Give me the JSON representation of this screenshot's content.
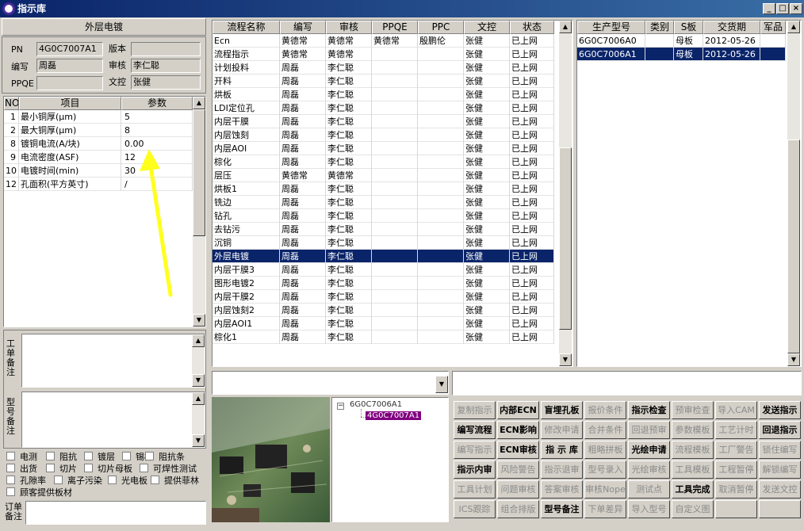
{
  "window": {
    "title": "指示库",
    "min": "_",
    "max": "□",
    "close": "×"
  },
  "left": {
    "section_title": "外层电镀",
    "pn_label": "PN",
    "pn_value": "4G0C7007A1",
    "version_label": "版本",
    "version_value": "",
    "writer_label": "编写",
    "writer_value": "周磊",
    "reviewer_label": "审核",
    "reviewer_value": "李仁聪",
    "ppqe_label": "PPQE",
    "ppqe_value": "",
    "doc_label": "文控",
    "doc_value": "张健",
    "param_headers": [
      "NO",
      "项目",
      "参数"
    ],
    "params": [
      {
        "no": "1",
        "item": "最小铜厚(μm)",
        "value": "5"
      },
      {
        "no": "2",
        "item": "最大铜厚(μm)",
        "value": "8"
      },
      {
        "no": "8",
        "item": "镀铜电流(A/块)",
        "value": "0.00"
      },
      {
        "no": "9",
        "item": "电流密度(ASF)",
        "value": "12"
      },
      {
        "no": "10",
        "item": "电镀时间(min)",
        "value": "30"
      },
      {
        "no": "12",
        "item": "孔面积(平方英寸)",
        "value": "/"
      }
    ],
    "note1_label": "工单备注",
    "note2_label": "型号备注",
    "checkboxes": [
      "电测",
      "阻抗",
      "镀层",
      "锡样",
      "阻抗条",
      "出货",
      "切片",
      "切片母板",
      "可焊性测试",
      "孔隙率",
      "离子污染",
      "光电板",
      "提供菲林",
      "顾客提供板材"
    ],
    "order_note_label": "订单备注"
  },
  "process_table": {
    "headers": [
      "流程名称",
      "编写",
      "审核",
      "PPQE",
      "PPC",
      "文控",
      "状态"
    ],
    "selected_index": 17,
    "rows": [
      [
        "Ecn",
        "黄德常",
        "黄德常",
        "黄德常",
        "殷鹏伦",
        "张健",
        "已上网"
      ],
      [
        "流程指示",
        "黄德常",
        "黄德常",
        "",
        "",
        "张健",
        "已上网"
      ],
      [
        "计划投料",
        "周磊",
        "李仁聪",
        "",
        "",
        "张健",
        "已上网"
      ],
      [
        "开料",
        "周磊",
        "李仁聪",
        "",
        "",
        "张健",
        "已上网"
      ],
      [
        "烘板",
        "周磊",
        "李仁聪",
        "",
        "",
        "张健",
        "已上网"
      ],
      [
        "LDI定位孔",
        "周磊",
        "李仁聪",
        "",
        "",
        "张健",
        "已上网"
      ],
      [
        "内层干膜",
        "周磊",
        "李仁聪",
        "",
        "",
        "张健",
        "已上网"
      ],
      [
        "内层蚀刻",
        "周磊",
        "李仁聪",
        "",
        "",
        "张健",
        "已上网"
      ],
      [
        "内层AOI",
        "周磊",
        "李仁聪",
        "",
        "",
        "张健",
        "已上网"
      ],
      [
        "棕化",
        "周磊",
        "李仁聪",
        "",
        "",
        "张健",
        "已上网"
      ],
      [
        "层压",
        "黄德常",
        "黄德常",
        "",
        "",
        "张健",
        "已上网"
      ],
      [
        "烘板1",
        "周磊",
        "李仁聪",
        "",
        "",
        "张健",
        "已上网"
      ],
      [
        "铣边",
        "周磊",
        "李仁聪",
        "",
        "",
        "张健",
        "已上网"
      ],
      [
        "钻孔",
        "周磊",
        "李仁聪",
        "",
        "",
        "张健",
        "已上网"
      ],
      [
        "去钻污",
        "周磊",
        "李仁聪",
        "",
        "",
        "张健",
        "已上网"
      ],
      [
        "沉铜",
        "周磊",
        "李仁聪",
        "",
        "",
        "张健",
        "已上网"
      ],
      [
        "外层电镀",
        "周磊",
        "李仁聪",
        "",
        "",
        "张健",
        "已上网"
      ],
      [
        "内层干膜3",
        "周磊",
        "李仁聪",
        "",
        "",
        "张健",
        "已上网"
      ],
      [
        "图形电镀2",
        "周磊",
        "李仁聪",
        "",
        "",
        "张健",
        "已上网"
      ],
      [
        "内层干膜2",
        "周磊",
        "李仁聪",
        "",
        "",
        "张健",
        "已上网"
      ],
      [
        "内层蚀刻2",
        "周磊",
        "李仁聪",
        "",
        "",
        "张健",
        "已上网"
      ],
      [
        "内层AOI1",
        "周磊",
        "李仁聪",
        "",
        "",
        "张健",
        "已上网"
      ],
      [
        "棕化1",
        "周磊",
        "李仁聪",
        "",
        "",
        "张健",
        "已上网"
      ]
    ]
  },
  "product_table": {
    "headers": [
      "生产型号",
      "类别",
      "S板",
      "交货期",
      "军品"
    ],
    "rows": [
      [
        "6G0C7006A0",
        "",
        "母板",
        "2012-05-26",
        ""
      ],
      [
        "6G0C7006A1",
        "",
        "母板",
        "2012-05-26",
        ""
      ]
    ]
  },
  "tree": {
    "root": "6G0C7006A1",
    "child": "4G0C7007A1"
  },
  "buttons": [
    [
      {
        "t": "复制指示",
        "s": "dis"
      },
      {
        "t": "内部ECN",
        "s": "en"
      },
      {
        "t": "盲埋孔板",
        "s": "en"
      },
      {
        "t": "报价条件",
        "s": "dis"
      },
      {
        "t": "指示检查",
        "s": "en"
      },
      {
        "t": "预审检查",
        "s": "dis"
      },
      {
        "t": "导入CAM",
        "s": "dis"
      },
      {
        "t": "发送指示",
        "s": "en"
      }
    ],
    [
      {
        "t": "编写流程",
        "s": "en"
      },
      {
        "t": "ECN影响",
        "s": "en"
      },
      {
        "t": "修改申请",
        "s": "dis"
      },
      {
        "t": "合并条件",
        "s": "dis"
      },
      {
        "t": "回退预审",
        "s": "dis"
      },
      {
        "t": "参数模板",
        "s": "dis"
      },
      {
        "t": "工艺计时",
        "s": "dis"
      },
      {
        "t": "回退指示",
        "s": "en"
      }
    ],
    [
      {
        "t": "编写指示",
        "s": "dis"
      },
      {
        "t": "ECN审核",
        "s": "en"
      },
      {
        "t": "指 示 库",
        "s": "en"
      },
      {
        "t": "粗略拼板",
        "s": "dis"
      },
      {
        "t": "光绘申请",
        "s": "en"
      },
      {
        "t": "流程模板",
        "s": "dis"
      },
      {
        "t": "工厂警告",
        "s": "dis"
      },
      {
        "t": "锁住编写",
        "s": "dis"
      }
    ],
    [
      {
        "t": "指示内审",
        "s": "en"
      },
      {
        "t": "风险警告",
        "s": "dis"
      },
      {
        "t": "指示退审",
        "s": "dis"
      },
      {
        "t": "型号录入",
        "s": "dis"
      },
      {
        "t": "光绘审核",
        "s": "dis"
      },
      {
        "t": "工具模板",
        "s": "dis"
      },
      {
        "t": "工程暂停",
        "s": "dis"
      },
      {
        "t": "解锁编写",
        "s": "dis"
      }
    ],
    [
      {
        "t": "工具计划",
        "s": "dis"
      },
      {
        "t": "问题审核",
        "s": "dis"
      },
      {
        "t": "答案审核",
        "s": "dis"
      },
      {
        "t": "审核Nope",
        "s": "dis"
      },
      {
        "t": "测试点",
        "s": "dis"
      },
      {
        "t": "工具完成",
        "s": "en"
      },
      {
        "t": "取消暂停",
        "s": "dis"
      },
      {
        "t": "发送文控",
        "s": "dis"
      }
    ],
    [
      {
        "t": "ICS跟踪",
        "s": "dis"
      },
      {
        "t": "组合排版",
        "s": "dis"
      },
      {
        "t": "型号备注",
        "s": "en"
      },
      {
        "t": "下单差异",
        "s": "dis"
      },
      {
        "t": "导入型号",
        "s": "dis"
      },
      {
        "t": "自定义图",
        "s": "dis"
      },
      {
        "t": "",
        "s": "dis"
      },
      {
        "t": "",
        "s": "dis"
      }
    ]
  ],
  "colors": {
    "selection": "#0a246a",
    "title_start": "#0a246a",
    "arrow": "#ffff1e"
  }
}
